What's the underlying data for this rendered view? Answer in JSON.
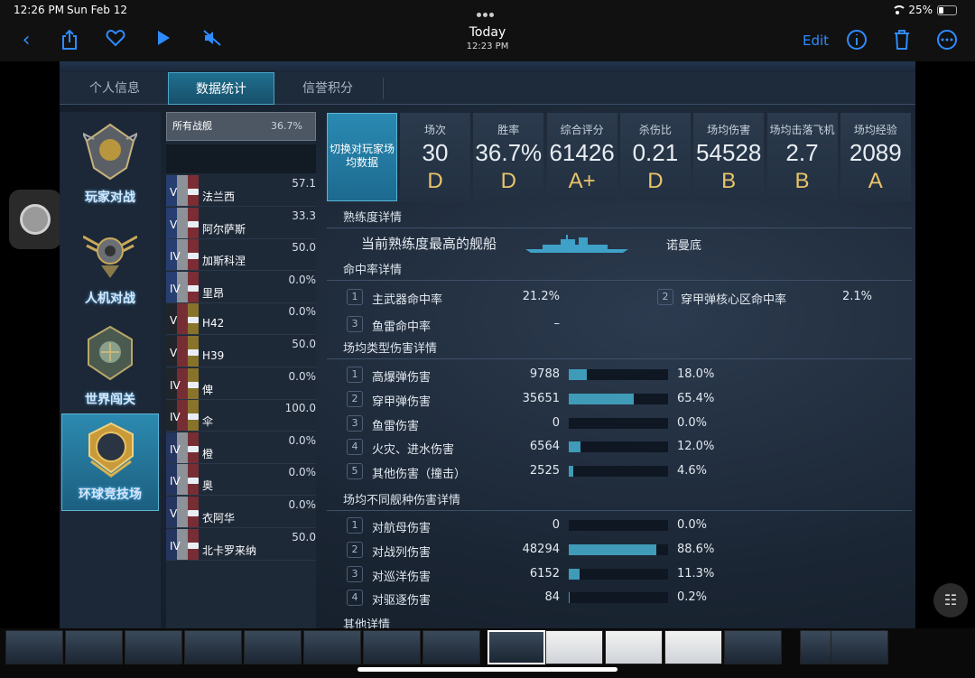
{
  "status_bar": {
    "time": "12:26 PM",
    "date": "Sun Feb 12",
    "battery": "25%"
  },
  "toolbar": {
    "title": "Today",
    "subtitle": "12:23 PM",
    "edit_label": "Edit"
  },
  "tabs": [
    {
      "label": "个人信息",
      "active": false
    },
    {
      "label": "数据统计",
      "active": true
    },
    {
      "label": "信誉积分",
      "active": false
    }
  ],
  "modes": [
    {
      "label": "玩家对战",
      "active": false
    },
    {
      "label": "人机对战",
      "active": false
    },
    {
      "label": "世界闯关",
      "active": false
    },
    {
      "label": "环球竞技场",
      "active": true
    }
  ],
  "ship_list": {
    "all_label": "所有战舰",
    "all_rate": "36.7%",
    "ships": [
      {
        "tier": "V",
        "name": "法兰西",
        "rate": "57.1",
        "flag": "france"
      },
      {
        "tier": "V",
        "name": "阿尔萨斯",
        "rate": "33.3",
        "flag": "france"
      },
      {
        "tier": "IV",
        "name": "加斯科涅",
        "rate": "50.0",
        "flag": "france"
      },
      {
        "tier": "IV",
        "name": "里昂",
        "rate": "0.0%",
        "flag": "france"
      },
      {
        "tier": "V",
        "name": "H42",
        "rate": "0.0%",
        "flag": "germany"
      },
      {
        "tier": "V",
        "name": "H39",
        "rate": "50.0",
        "flag": "germany"
      },
      {
        "tier": "IV",
        "name": "俾",
        "rate": "0.0%",
        "flag": "germany"
      },
      {
        "tier": "IV",
        "name": "伞",
        "rate": "100.0",
        "flag": "germany"
      },
      {
        "tier": "IV",
        "name": "橙",
        "rate": "0.0%",
        "flag": "usa"
      },
      {
        "tier": "IV",
        "name": "奥",
        "rate": "0.0%",
        "flag": "usa"
      },
      {
        "tier": "V",
        "name": "衣阿华",
        "rate": "0.0%",
        "flag": "usa"
      },
      {
        "tier": "IV",
        "name": "北卡罗来纳",
        "rate": "50.0",
        "flag": "usa"
      }
    ]
  },
  "switch_button": "切换对玩家场均数据",
  "stats": [
    {
      "label": "场次",
      "value": "30",
      "grade": "D"
    },
    {
      "label": "胜率",
      "value": "36.7%",
      "grade": "D"
    },
    {
      "label": "综合评分",
      "value": "61426",
      "grade": "A+"
    },
    {
      "label": "杀伤比",
      "value": "0.21",
      "grade": "D"
    },
    {
      "label": "场均伤害",
      "value": "54528",
      "grade": "B"
    },
    {
      "label": "场均击落飞机",
      "value": "2.7",
      "grade": "B"
    },
    {
      "label": "场均经验",
      "value": "2089",
      "grade": "A"
    }
  ],
  "mastery": {
    "title": "熟练度详情",
    "text": "当前熟练度最高的舰船",
    "ship": "诺曼底"
  },
  "accuracy": {
    "title": "命中率详情",
    "items": [
      {
        "n": "1",
        "label": "主武器命中率",
        "value": "21.2%"
      },
      {
        "n": "2",
        "label": "穿甲弹核心区命中率",
        "value": "2.1%"
      },
      {
        "n": "3",
        "label": "鱼雷命中率",
        "value": "–"
      }
    ]
  },
  "damage_type": {
    "title": "场均类型伤害详情",
    "items": [
      {
        "n": "1",
        "label": "高爆弹伤害",
        "value": "9788",
        "pct": "18.0%",
        "fill": 0.18
      },
      {
        "n": "2",
        "label": "穿甲弹伤害",
        "value": "35651",
        "pct": "65.4%",
        "fill": 0.654
      },
      {
        "n": "3",
        "label": "鱼雷伤害",
        "value": "0",
        "pct": "0.0%",
        "fill": 0.0
      },
      {
        "n": "4",
        "label": "火灾、进水伤害",
        "value": "6564",
        "pct": "12.0%",
        "fill": 0.12
      },
      {
        "n": "5",
        "label": "其他伤害（撞击）",
        "value": "2525",
        "pct": "4.6%",
        "fill": 0.046
      }
    ]
  },
  "damage_class": {
    "title": "场均不同舰种伤害详情",
    "items": [
      {
        "n": "1",
        "label": "对航母伤害",
        "value": "0",
        "pct": "0.0%",
        "fill": 0.0
      },
      {
        "n": "2",
        "label": "对战列伤害",
        "value": "48294",
        "pct": "88.6%",
        "fill": 0.886
      },
      {
        "n": "3",
        "label": "对巡洋伤害",
        "value": "6152",
        "pct": "11.3%",
        "fill": 0.113
      },
      {
        "n": "4",
        "label": "对驱逐伤害",
        "value": "84",
        "pct": "0.2%",
        "fill": 0.002
      }
    ]
  },
  "other": {
    "title": "其他详情"
  }
}
